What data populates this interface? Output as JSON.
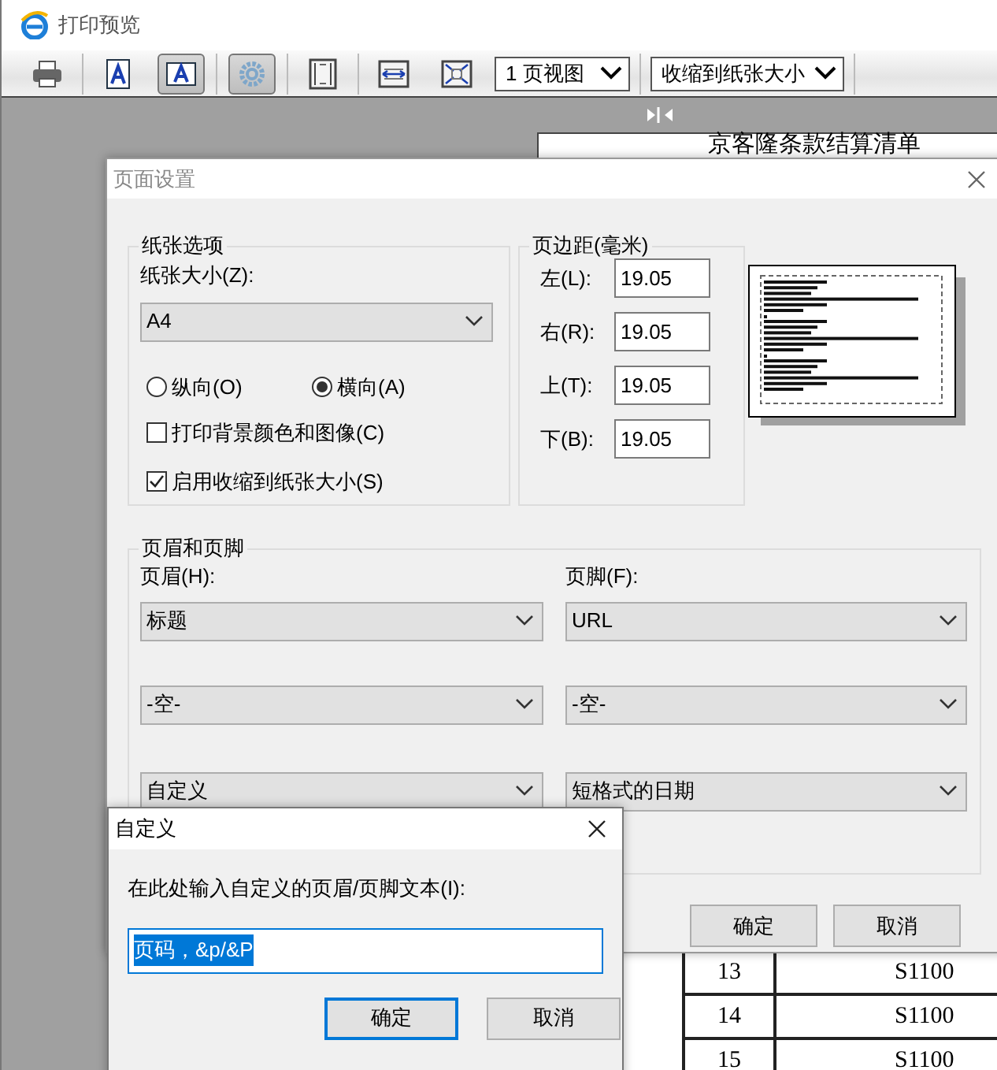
{
  "window": {
    "title": "打印预览"
  },
  "toolbar": {
    "buttons": [
      {
        "kind": "print",
        "pressed": false
      },
      {
        "kind": "portrait",
        "pressed": false
      },
      {
        "kind": "landscape",
        "pressed": true
      },
      {
        "kind": "settings",
        "pressed": true
      },
      {
        "kind": "page",
        "pressed": false
      },
      {
        "kind": "fit_width",
        "pressed": false
      },
      {
        "kind": "fit_page",
        "pressed": false
      }
    ],
    "view_select": "1 页视图",
    "scale_select": "收缩到纸张大小"
  },
  "preview": {
    "title": "京客隆条款结算清单",
    "rows": [
      [
        "13",
        "S1100"
      ],
      [
        "14",
        "S1100"
      ],
      [
        "15",
        "S1100"
      ]
    ]
  },
  "page_setup": {
    "title": "页面设置",
    "paper_options": {
      "legend": "纸张选项",
      "size_label": "纸张大小(Z):",
      "size": "A4",
      "orientation": [
        {
          "label": "纵向(O)",
          "selected": false
        },
        {
          "label": "横向(A)",
          "selected": true
        }
      ],
      "options": [
        {
          "label": "打印背景颜色和图像(C)",
          "checked": false
        },
        {
          "label": "启用收缩到纸张大小(S)",
          "checked": true
        }
      ]
    },
    "margins": {
      "legend": "页边距(毫米)",
      "fields": [
        {
          "label": "左(L):",
          "value": "19.05"
        },
        {
          "label": "右(R):",
          "value": "19.05"
        },
        {
          "label": "上(T):",
          "value": "19.05"
        },
        {
          "label": "下(B):",
          "value": "19.05"
        }
      ]
    },
    "header_footer": {
      "legend": "页眉和页脚",
      "header_label": "页眉(H):",
      "footer_label": "页脚(F):",
      "header": [
        "标题",
        "-空-",
        "自定义"
      ],
      "footer": [
        "URL",
        "-空-",
        "短格式的日期"
      ]
    },
    "buttons": [
      "确定",
      "取消"
    ]
  },
  "custom_dialog": {
    "title": "自定义",
    "prompt": "在此处输入自定义的页眉/页脚文本(I):",
    "value": "页码，&p/&P",
    "value_selected": true,
    "buttons": [
      {
        "label": "确定",
        "default": true
      },
      {
        "label": "取消",
        "default": false
      }
    ]
  }
}
